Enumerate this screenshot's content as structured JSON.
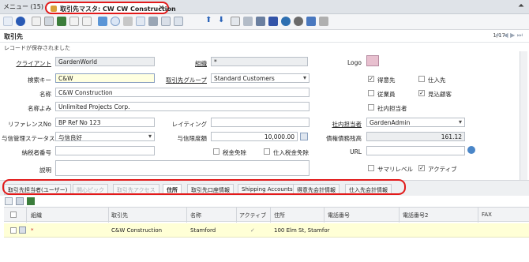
{
  "tabbar": {
    "menu_label": "メニュー (15)",
    "doc_tab_title": "取引先マスタ: CW CW Construction",
    "close": "×",
    "collapse": "⏶"
  },
  "header": {
    "title": "取引先",
    "record_nav": "1/17"
  },
  "message": "レコードが保存されました",
  "form": {
    "client_label": "クライアント",
    "client_value": "GardenWorld",
    "org_label": "組織",
    "org_value": "*",
    "logo_label": "Logo",
    "search_key_label": "検索キー",
    "search_key_value": "C&W",
    "bp_group_label": "取引先グループ",
    "bp_group_value": "Standard Customers",
    "name_label": "名称",
    "name_value": "C&W Construction",
    "name2_label": "名称よみ",
    "name2_value": "Unlimited Projects Corp.",
    "reference_label": "リファレンスNo",
    "reference_value": "BP Ref No 123",
    "rating_label": "レイティング",
    "rating_value": "",
    "sales_rep_label": "社内担当者",
    "sales_rep_value": "GardenAdmin",
    "credit_status_label": "与信管理ステータス",
    "credit_status_value": "与信良好",
    "credit_limit_label": "与信限度額",
    "credit_limit_value": "10,000.00",
    "open_balance_label": "債権債務残高",
    "open_balance_value": "161.12",
    "tax_id_label": "納税者番号",
    "tax_id_value": "",
    "tax_exempt_label": "税金免除",
    "po_tax_exempt_label": "仕入税金免除",
    "url_label": "URL",
    "url_value": "",
    "description_label": "説明",
    "description_value": "",
    "customer_label": "得意先",
    "vendor_label": "仕入先",
    "employee_label": "従業員",
    "prospect_label": "見込顧客",
    "sales_rep_flag_label": "社内担当者",
    "summary_label": "サマリレベル",
    "active_label": "アクティブ"
  },
  "tabs": [
    {
      "label": "取引先担当者(ユーザー)",
      "state": "normal"
    },
    {
      "label": "開心ピック",
      "state": "disabled"
    },
    {
      "label": "取引先アクセス",
      "state": "disabled"
    },
    {
      "label": "住所",
      "state": "active"
    },
    {
      "label": "取引先口座情報",
      "state": "normal"
    },
    {
      "label": "Shipping Accounts",
      "state": "normal"
    },
    {
      "label": "得意先会計情報",
      "state": "normal"
    },
    {
      "label": "仕入先会計情報",
      "state": "normal"
    }
  ],
  "grid": {
    "columns": [
      "組織",
      "取引先",
      "名称",
      "アクティブ",
      "住所",
      "電話番号",
      "電話番号2",
      "FAX"
    ],
    "rows": [
      {
        "org": "*",
        "bp": "C&W Construction",
        "name": "Stamford",
        "active": "✓",
        "address": "100 Elm St, Stamfor",
        "phone": "",
        "phone2": "",
        "fax": ""
      }
    ]
  },
  "colors": {
    "accent": "#e21a1a",
    "highlight": "#ffffd6"
  }
}
